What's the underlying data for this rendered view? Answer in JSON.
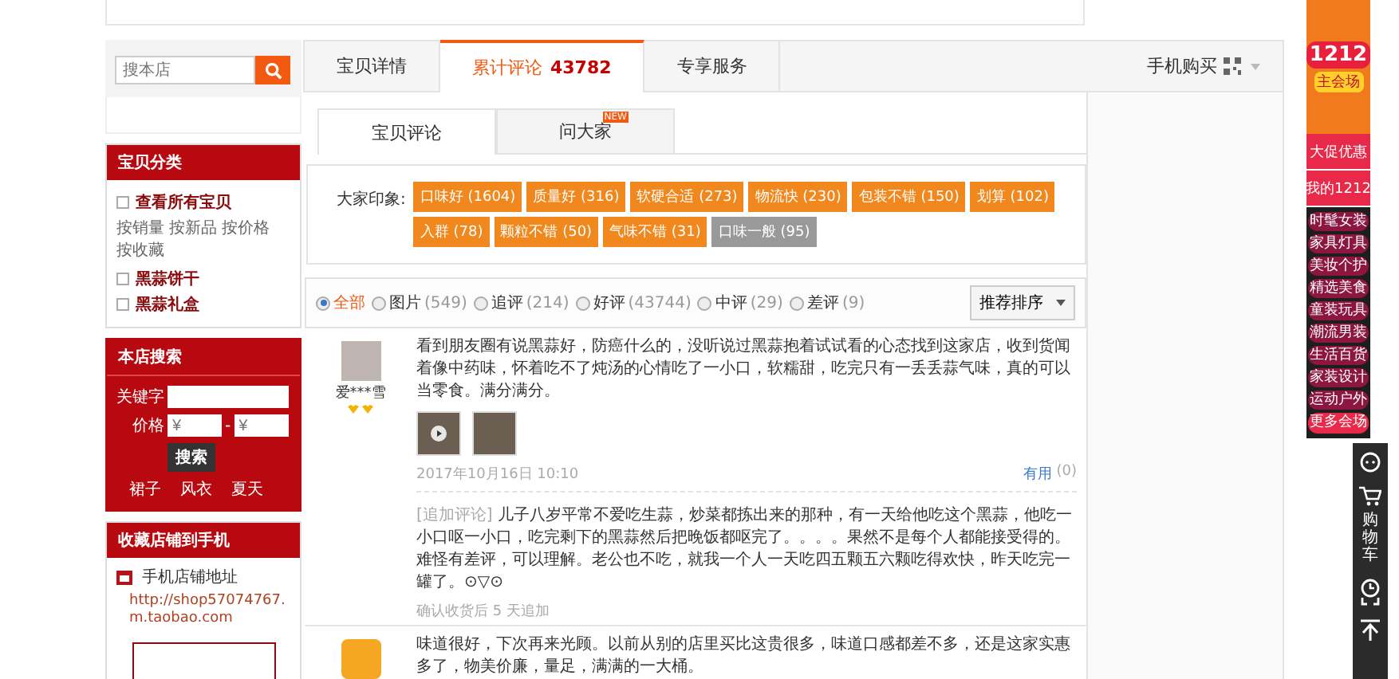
{
  "shop_search": {
    "placeholder": "搜本店"
  },
  "categories": {
    "title": "宝贝分类",
    "items": [
      {
        "label": "查看所有宝贝",
        "links": [
          "按销量",
          "按新品",
          "按价格",
          "按收藏"
        ]
      },
      {
        "label": "黑蒜饼干"
      },
      {
        "label": "黑蒜礼盒"
      }
    ]
  },
  "store_search": {
    "title": "本店搜索",
    "keyword_label": "关键字",
    "price_label": "价格",
    "price_min_placeholder": "¥",
    "price_separator": "-",
    "price_max_placeholder": "¥",
    "button": "搜索",
    "hot_words": [
      "裙子",
      "风衣",
      "夏天"
    ]
  },
  "mobile_store": {
    "title": "收藏店铺到手机",
    "address_label": "手机店铺地址",
    "url": "http://shop57074767.m.taobao.com"
  },
  "tabs": [
    {
      "label": "宝贝详情",
      "selected": false
    },
    {
      "label": "累计评论",
      "count": "43782",
      "selected": true
    },
    {
      "label": "专享服务",
      "selected": false
    }
  ],
  "mobile_buy": "手机购买",
  "sub_tabs": [
    {
      "label": "宝贝评论",
      "selected": true
    },
    {
      "label": "问大家",
      "badge": "NEW",
      "selected": false
    }
  ],
  "impressions": {
    "label": "大家印象:",
    "tags": [
      {
        "text": "口味好 (1604)",
        "negative": false
      },
      {
        "text": "质量好 (316)",
        "negative": false
      },
      {
        "text": "软硬合适 (273)",
        "negative": false
      },
      {
        "text": "物流快 (230)",
        "negative": false
      },
      {
        "text": "包装不错 (150)",
        "negative": false
      },
      {
        "text": "划算 (102)",
        "negative": false
      },
      {
        "text": "入群 (78)",
        "negative": false
      },
      {
        "text": "颗粒不错 (50)",
        "negative": false
      },
      {
        "text": "气味不错 (31)",
        "negative": false
      },
      {
        "text": "口味一般 (95)",
        "negative": true
      }
    ]
  },
  "filters": [
    {
      "label": "全部",
      "selected": true
    },
    {
      "label": "图片",
      "count": "(549)",
      "selected": false
    },
    {
      "label": "追评",
      "count": "(214)",
      "selected": false
    },
    {
      "label": "好评",
      "count": "(43744)",
      "selected": false
    },
    {
      "label": "中评",
      "count": "(29)",
      "selected": false
    },
    {
      "label": "差评",
      "count": "(9)",
      "selected": false
    }
  ],
  "sort": "推荐排序",
  "reviews": [
    {
      "user": "爱***雪",
      "text": "看到朋友圈有说黑蒜好，防癌什么的，没听说过黑蒜抱着试试看的心态找到这家店，收到货闻着像中药味，怀着吃不了炖汤的心情吃了一小口，软糯甜，吃完只有一丢丢蒜气味，真的可以当零食。满分满分。",
      "photos": [
        {
          "video": true
        },
        {
          "video": false
        }
      ],
      "date": "2017年10月16日 10:10",
      "useful": "有用",
      "useful_count": "(0)",
      "followup_label": "[追加评论]",
      "followup": "儿子八岁平常不爱吃生蒜，炒菜都拣出来的那种，有一天给他吃这个黑蒜，他吃一小口呕一小口，吃完剩下的黑蒜然后把晚饭都呕完了。。。。果然不是每个人都能接受得的。难怪有差评，可以理解。老公也不吃，就我一个人一天吃四五颗五六颗吃得欢快，昨天吃完一罐了。⊙▽⊙",
      "followup_time": "确认收货后 5 天追加"
    },
    {
      "text": "味道很好，下次再来光顾。以前从别的店里买比这贵很多，味道口感都差不多，还是这家实惠多了，物美价廉，量足，满满的一大桶。"
    }
  ],
  "promo": {
    "banner_number": "1212",
    "banner_caption": "主会场",
    "deal": "大促优惠",
    "my_event": "我的1212",
    "venues": [
      "时髦女装",
      "家具灯具",
      "美妆个护",
      "精选美食",
      "童装玩具",
      "潮流男装",
      "生活百货",
      "家装设计",
      "运动户外"
    ],
    "more": "更多会场"
  },
  "toolbar": {
    "cart": "购物车"
  }
}
